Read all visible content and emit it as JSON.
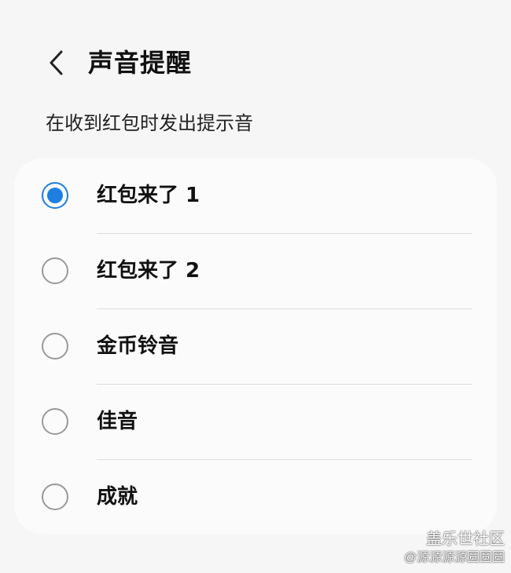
{
  "header": {
    "back_icon": "chevron-left-icon",
    "title": "声音提醒"
  },
  "subtitle": "在收到红包时发出提示音",
  "options": [
    {
      "label": "红包来了 1",
      "selected": true
    },
    {
      "label": "红包来了 2",
      "selected": false
    },
    {
      "label": "金币铃音",
      "selected": false
    },
    {
      "label": "佳音",
      "selected": false
    },
    {
      "label": "成就",
      "selected": false
    }
  ],
  "colors": {
    "accent": "#1f7fe0",
    "background": "#f6f6f6",
    "card": "#fbfbfb"
  },
  "watermark": {
    "title": "盖乐世社区",
    "user": "@源源源源圆圆圆"
  }
}
